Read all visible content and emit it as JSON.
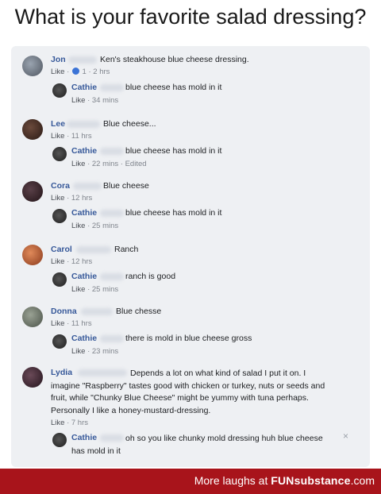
{
  "meme": {
    "title": "What is your favorite salad dressing?"
  },
  "comments": [
    {
      "name": "Jon",
      "text": "Ken's steakhouse blue cheese dressing.",
      "like": "Like",
      "meta_count": "1",
      "meta_sep": " · ",
      "meta_time": "2 hrs"
    },
    {
      "name": "Cathie",
      "text": "blue cheese has mold in it",
      "like": "Like",
      "meta_time": " · 34 mins"
    },
    {
      "name": "Lee",
      "text": "Blue cheese...",
      "like": "Like",
      "meta_time": " · 11 hrs"
    },
    {
      "name": "Cathie",
      "text": "blue cheese has mold in it",
      "like": "Like",
      "meta_time": " · 22 mins · Edited"
    },
    {
      "name": "Cora",
      "text": "Blue cheese",
      "like": "Like",
      "meta_time": " · 12 hrs"
    },
    {
      "name": "Cathie",
      "text": "blue cheese has mold in it",
      "like": "Like",
      "meta_time": " · 25 mins"
    },
    {
      "name": "Carol",
      "text": "Ranch",
      "like": "Like",
      "meta_time": " · 12 hrs"
    },
    {
      "name": "Cathie",
      "text": "ranch is good",
      "like": "Like",
      "meta_time": " · 25 mins"
    },
    {
      "name": "Donna",
      "text": "Blue chesse",
      "like": "Like",
      "meta_time": " · 11 hrs"
    },
    {
      "name": "Cathie",
      "text": "there is mold in blue cheese gross",
      "like": "Like",
      "meta_time": " · 23 mins"
    }
  ],
  "lydia": {
    "name": "Lydia",
    "line1": "Depends a lot on what kind of salad I put it on. I",
    "line2": "imagine \"Raspberry\" tastes good with chicken or turkey, nuts or seeds and",
    "line3": "fruit, while \"Chunky Blue Cheese\" might be yummy with tuna perhaps.",
    "line4": "Personally I like a honey-mustard-dressing.",
    "like": "Like",
    "meta_time": " · 7 hrs"
  },
  "last": {
    "name": "Cathie",
    "line1": "oh so you like chunky mold dressing huh blue cheese",
    "line2": "has mold in it",
    "close": "×"
  },
  "footer": {
    "prefix": "More laughs at ",
    "brand": "FUNsubstance",
    "suffix": ".com"
  },
  "colors": {
    "name_link": "#365899",
    "card_bg": "#eef0f3",
    "footer_bg": "#a8141b"
  }
}
